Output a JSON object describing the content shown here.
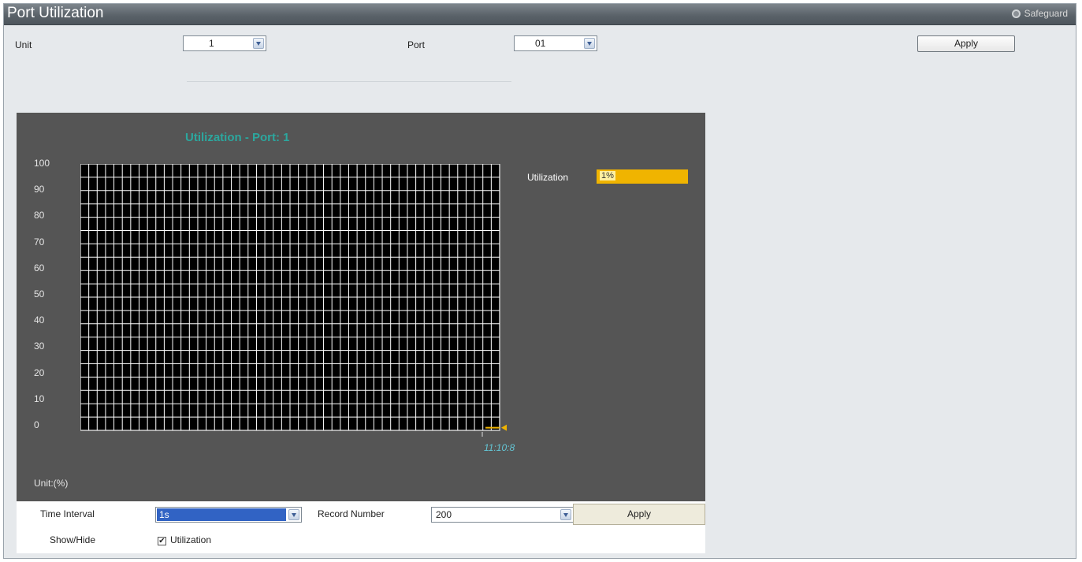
{
  "header": {
    "title": "Port Utilization",
    "safeguard_label": "Safeguard"
  },
  "form": {
    "unit_label": "Unit",
    "unit_value": "1",
    "port_label": "Port",
    "port_value": "01",
    "apply_label": "Apply"
  },
  "chart_data": {
    "type": "line",
    "title": "Utilization - Port: 1",
    "yticks": [
      "100",
      "90",
      "80",
      "70",
      "60",
      "50",
      "40",
      "30",
      "20",
      "10",
      "0"
    ],
    "ylim": [
      0,
      100
    ],
    "ylabel": "Unit:(%)",
    "grid": true,
    "series": [
      {
        "name": "Utilization",
        "x": [
          "11:10:8"
        ],
        "values": [
          1
        ],
        "color": "#f0b400"
      }
    ],
    "latest_time": "11:10:8"
  },
  "legend": {
    "label": "Utilization",
    "value": "1%"
  },
  "controls": {
    "time_interval_label": "Time Interval",
    "time_interval_value": "1s",
    "record_number_label": "Record Number",
    "record_number_value": "200",
    "apply_label": "Apply",
    "showhide_label": "Show/Hide",
    "utilization_checkbox_label": "Utilization",
    "check_mark": "✔"
  },
  "colors": {
    "chart_bg": "#555555",
    "plot_bg": "#000000",
    "grid": "#ffffff",
    "title": "#2ca79e",
    "utilization": "#f0b400",
    "time_label": "#64c7d6"
  }
}
